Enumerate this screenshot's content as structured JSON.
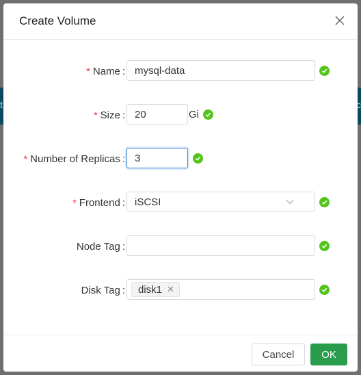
{
  "background": {
    "left_edge_text": "t",
    "right_edge_text": "c"
  },
  "modal": {
    "title": "Create Volume",
    "close_icon": "close-icon"
  },
  "form": {
    "name": {
      "label": "Name",
      "required": "*",
      "value": "mysql-data"
    },
    "size": {
      "label": "Size",
      "required": "*",
      "value": "20",
      "unit": "Gi"
    },
    "replicas": {
      "label": "Number of Replicas",
      "required": "*",
      "value": "3"
    },
    "frontend": {
      "label": "Frontend",
      "required": "*",
      "value": "iSCSI"
    },
    "node_tag": {
      "label": "Node Tag",
      "value": ""
    },
    "disk_tag": {
      "label": "Disk Tag",
      "tags": [
        "disk1"
      ]
    },
    "colon": ":"
  },
  "footer": {
    "cancel_label": "Cancel",
    "ok_label": "OK"
  },
  "colors": {
    "success": "#52c41a",
    "required": "#f5222d",
    "primary_button": "#2a9d4c",
    "focus_border": "#3a83d6"
  }
}
